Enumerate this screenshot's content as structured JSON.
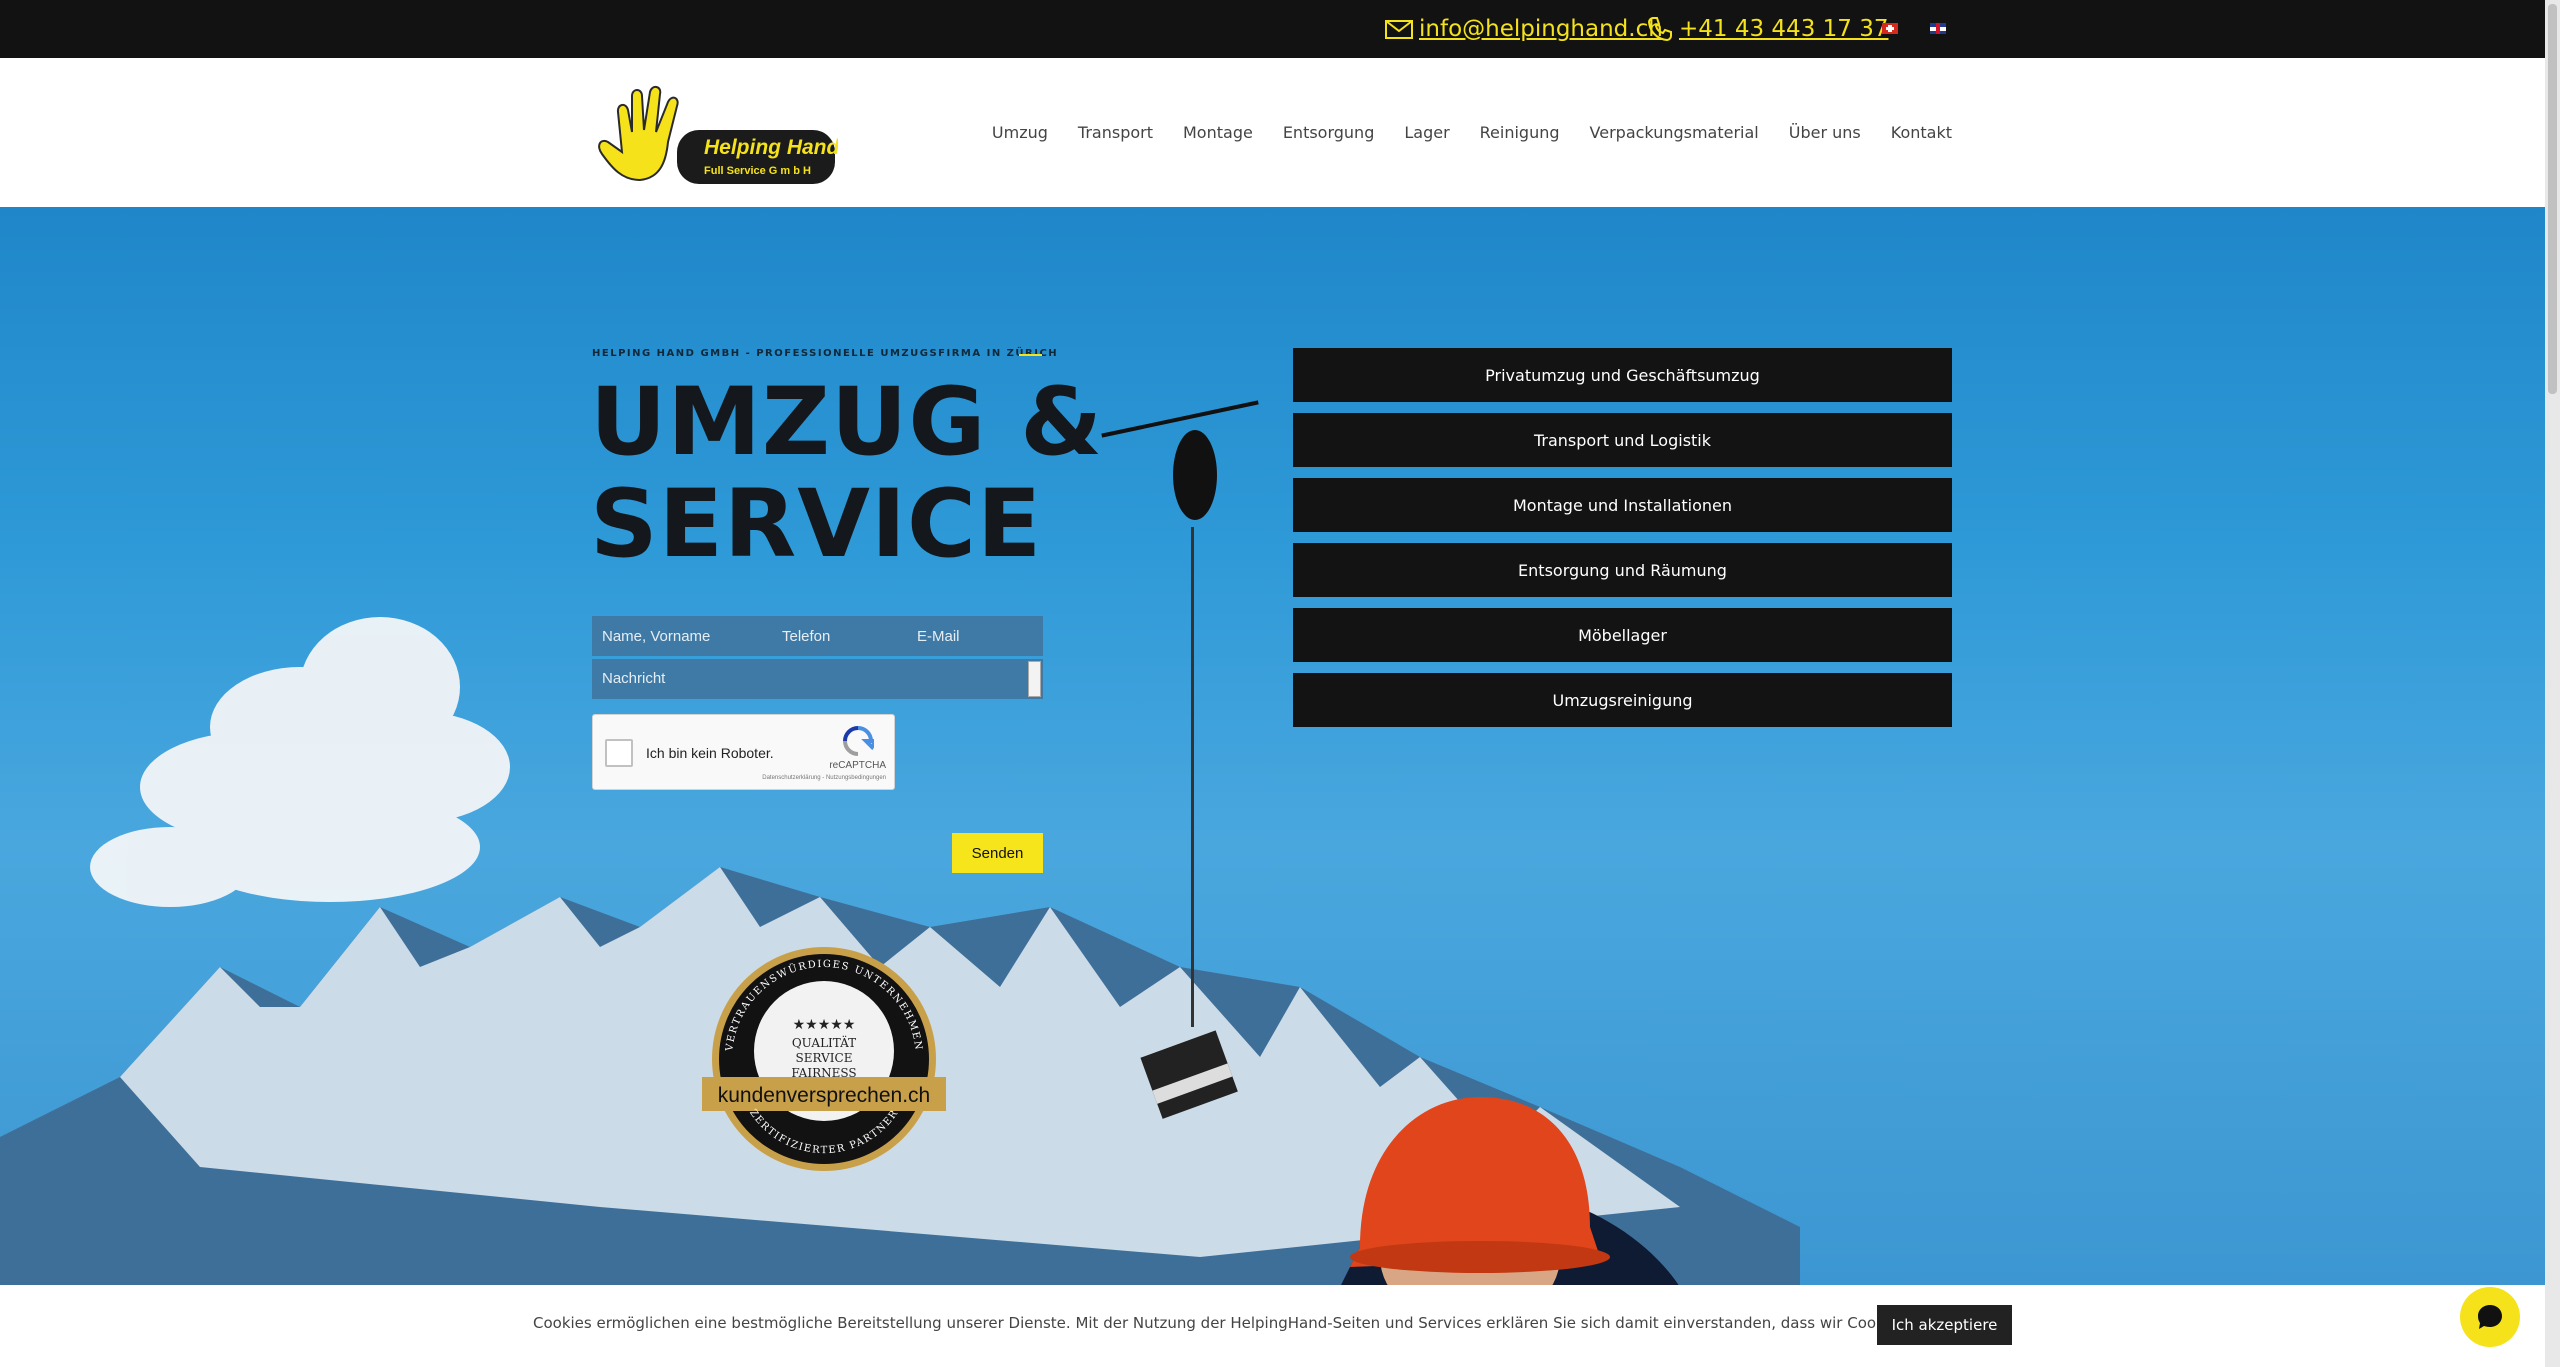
{
  "topbar": {
    "email": "info@helpinghand.ch",
    "phone": "+41 43 443 17 37",
    "languages": [
      "de-ch-flag-icon",
      "en-gb-flag-icon"
    ]
  },
  "logo": {
    "name": "Helping Hand",
    "tagline": "Full Service G m b H"
  },
  "nav": {
    "items": [
      "Umzug",
      "Transport",
      "Montage",
      "Entsorgung",
      "Lager",
      "Reinigung",
      "Verpackungsmaterial",
      "Über uns",
      "Kontakt"
    ]
  },
  "hero": {
    "kicker": "HELPING HAND GMBH - PROFESSIONELLE UMZUGSFIRMA IN ZÜRICH",
    "title_line1": "UMZUG &",
    "title_line2": "SERVICE"
  },
  "form": {
    "name_placeholder": "Name, Vorname",
    "phone_placeholder": "Telefon",
    "email_placeholder": "E-Mail",
    "message_placeholder": "Nachricht",
    "captcha_label": "Ich bin kein Roboter.",
    "captcha_brand": "reCAPTCHA",
    "captcha_terms": "Datenschutzerklärung - Nutzungsbedingungen",
    "submit_label": "Senden"
  },
  "services": {
    "items": [
      "Privatumzug und Geschäftsumzug",
      "Transport und Logistik",
      "Montage und Installationen",
      "Entsorgung und Räumung",
      "Möbellager",
      "Umzugsreinigung"
    ]
  },
  "badge": {
    "top_arc": "VERTRAUENSWÜRDIGES UNTERNEHMEN",
    "line1": "QUALITÄT",
    "line2": "SERVICE",
    "line3": "FAIRNESS",
    "brand": "kundenversprechen.ch",
    "bottom_arc": "ZERTIFIZIERTER PARTNER"
  },
  "cookie": {
    "text": "Cookies ermöglichen eine bestmögliche Bereitstellung unserer Dienste. Mit der Nutzung der HelpingHand-Seiten und Services erklären Sie sich damit einverstanden, dass wir Cookies verwenden",
    "accept_label": "Ich akzeptiere"
  },
  "colors": {
    "accent_yellow": "#f4e21a",
    "topbar_bg": "#121212",
    "button_dark": "#131313",
    "sky_blue": "#2f9ad8"
  }
}
